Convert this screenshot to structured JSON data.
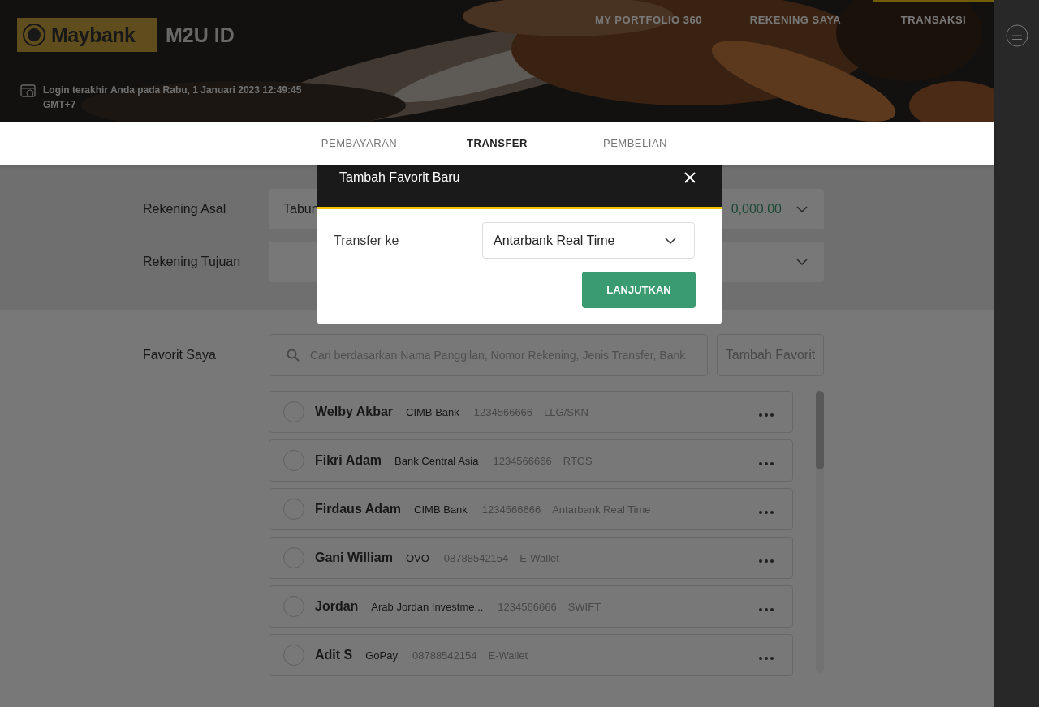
{
  "header": {
    "logo": "Maybank",
    "product": "M2U ID",
    "last_login": [
      "Login terakhir Anda pada Rabu, 1 Januari 2023 12:49:45",
      "GMT+7"
    ]
  },
  "nav": [
    {
      "label": "MY PORTFOLIO 360",
      "selected": false
    },
    {
      "label": "REKENING SAYA",
      "selected": false
    },
    {
      "label": "TRANSAKSI",
      "selected": true
    }
  ],
  "subtabs": [
    {
      "label": "PEMBAYARAN",
      "selected": false
    },
    {
      "label": "TRANSFER",
      "selected": true
    },
    {
      "label": "PEMBELIAN",
      "selected": false
    }
  ],
  "form": [
    {
      "label": "Rekening Asal",
      "value": "Tabun",
      "amount": "0,000.00"
    },
    {
      "label": "Rekening Tujuan"
    }
  ],
  "favorites": {
    "label": "Favorit Saya",
    "search_placeholder": "Cari berdasarkan Nama Panggilan, Nomor Rekening, Jenis Transfer, Bank",
    "add_button": "Tambah Favorit",
    "items": [
      {
        "name": "Welby Akbar",
        "bank": "CIMB Bank",
        "account": "1234566666",
        "type": "LLG/SKN",
        "selected": false
      },
      {
        "name": "Fikri Adam",
        "bank": "Bank Central Asia",
        "account": "1234566666",
        "type": "RTGS",
        "selected": false
      },
      {
        "name": "Firdaus Adam",
        "bank": "CIMB Bank",
        "account": "1234566666",
        "type": "Antarbank Real Time",
        "selected": false
      },
      {
        "name": "Gani William",
        "bank": "OVO",
        "account": "08788542154",
        "type": "E-Wallet",
        "selected": false
      },
      {
        "name": "Jordan",
        "bank": "Arab Jordan Investme...",
        "account": "1234566666",
        "type": "SWIFT",
        "selected": false
      },
      {
        "name": "Adit S",
        "bank": "GoPay",
        "account": "08788542154",
        "type": "E-Wallet",
        "selected": false
      }
    ]
  },
  "modal": {
    "title": "Tambah Favorit Baru",
    "field_label": "Transfer ke",
    "select_value": "Antarbank Real Time",
    "button": "LANJUTKAN"
  }
}
